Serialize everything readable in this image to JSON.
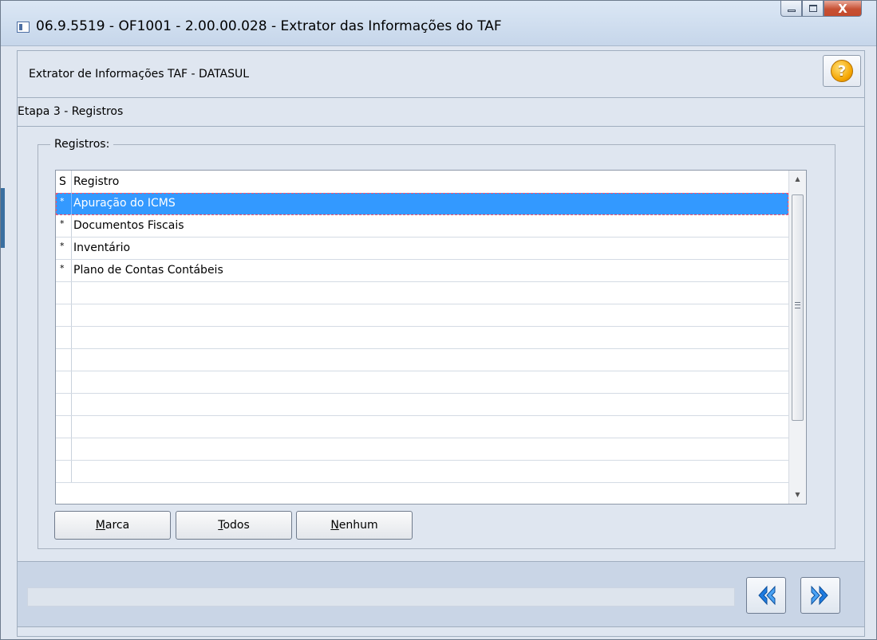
{
  "window": {
    "title": "06.9.5519 - OF1001 - 2.00.00.028 - Extrator das Informações do TAF",
    "close_glyph": "X"
  },
  "header": {
    "title": "Extrator de Informações TAF - DATASUL",
    "help_glyph": "?"
  },
  "step": {
    "label": "Etapa 3 - Registros"
  },
  "group": {
    "label": "Registros:"
  },
  "grid": {
    "columns": [
      "S",
      "Registro"
    ],
    "rows": [
      {
        "s": "*",
        "registro": "Apuração do ICMS",
        "selected": true
      },
      {
        "s": "*",
        "registro": "Documentos Fiscais",
        "selected": false
      },
      {
        "s": "*",
        "registro": "Inventário",
        "selected": false
      },
      {
        "s": "*",
        "registro": "Plano de Contas Contábeis",
        "selected": false
      }
    ],
    "empty_rows": 9
  },
  "buttons": {
    "marca": {
      "mnemonic": "M",
      "rest": "arca"
    },
    "todos": {
      "mnemonic": "T",
      "rest": "odos"
    },
    "nenhum": {
      "mnemonic": "N",
      "rest": "enhum"
    }
  },
  "colors": {
    "selection": "#3399ff",
    "window_bg": "#dfe6f0",
    "footer_bg": "#c9d5e6",
    "nav_arrow": "#1e7be0"
  },
  "icons": {
    "back": "double-left-arrow-icon",
    "forward": "double-right-arrow-icon",
    "help": "help-icon"
  }
}
